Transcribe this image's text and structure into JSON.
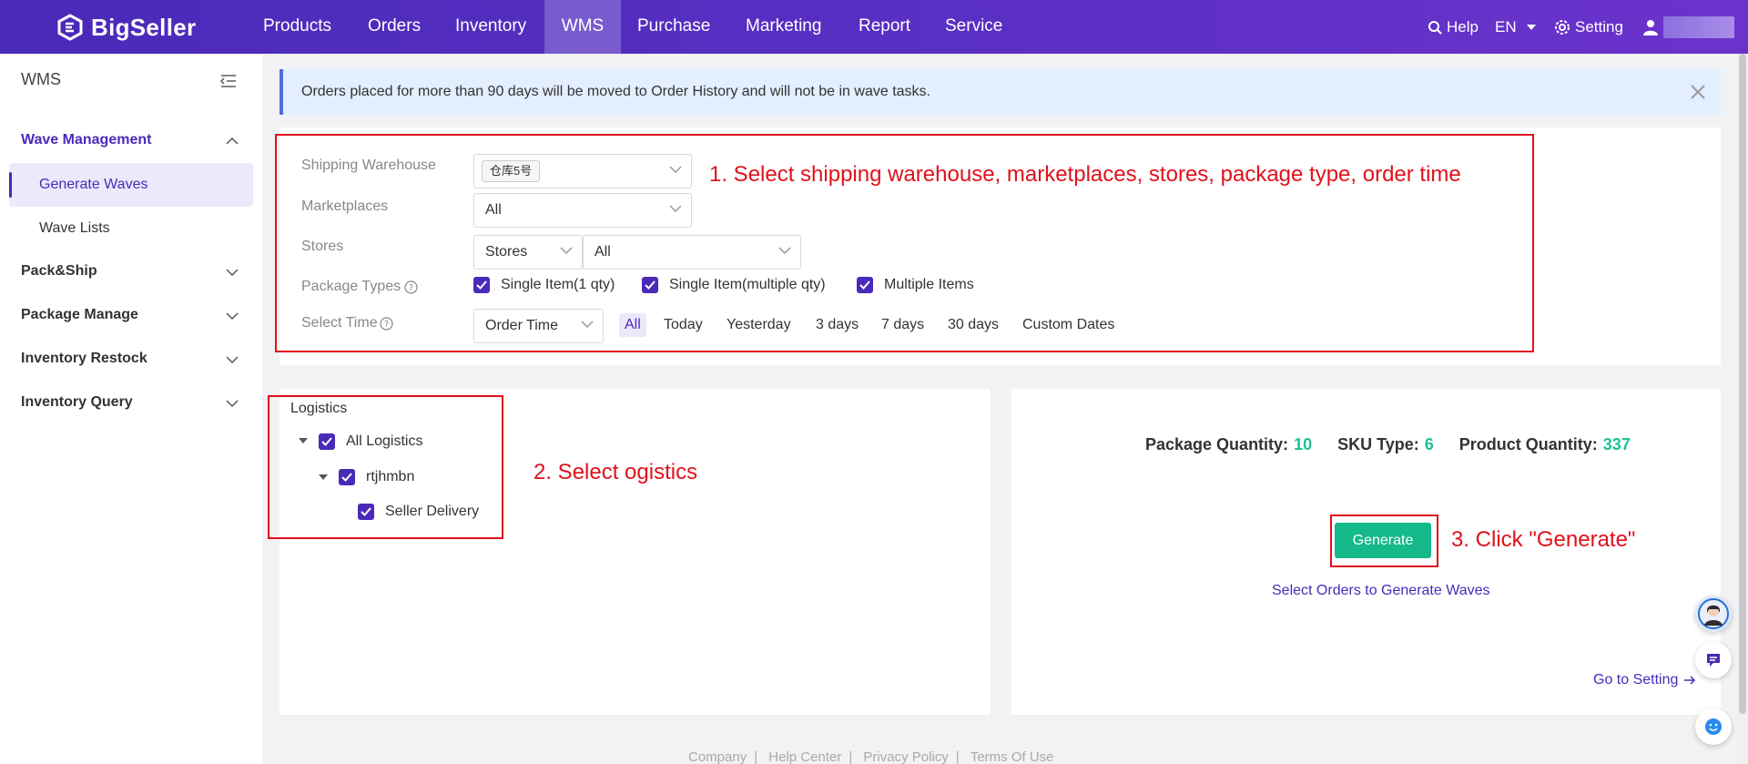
{
  "brand": {
    "name": "BigSeller"
  },
  "nav": {
    "items": [
      "Products",
      "Orders",
      "Inventory",
      "WMS",
      "Purchase",
      "Marketing",
      "Report",
      "Service"
    ],
    "active": "WMS",
    "help": "Help",
    "lang": "EN",
    "setting": "Setting"
  },
  "sidebar": {
    "title": "WMS",
    "groups": [
      {
        "label": "Wave Management",
        "open": true
      },
      {
        "label": "Pack&Ship"
      },
      {
        "label": "Package Manage"
      },
      {
        "label": "Inventory Restock"
      },
      {
        "label": "Inventory Query"
      }
    ],
    "sub_items": [
      {
        "label": "Generate Waves",
        "active": true
      },
      {
        "label": "Wave Lists"
      }
    ]
  },
  "notice": {
    "text": "Orders placed for more than 90 days will be moved to Order History and will not be in wave tasks."
  },
  "filters": {
    "shipping_warehouse": {
      "label": "Shipping Warehouse",
      "value": "仓库5号"
    },
    "marketplaces": {
      "label": "Marketplaces",
      "value": "All"
    },
    "stores": {
      "label": "Stores",
      "type": "Stores",
      "value": "All"
    },
    "package_types": {
      "label": "Package Types",
      "options": [
        "Single Item(1 qty)",
        "Single Item(multiple qty)",
        "Multiple Items"
      ]
    },
    "select_time": {
      "label": "Select Time",
      "type": "Order Time",
      "options": [
        "All",
        "Today",
        "Yesterday",
        "3 days",
        "7 days",
        "30 days",
        "Custom Dates"
      ],
      "active": "All"
    }
  },
  "logistics": {
    "title": "Logistics",
    "tree": [
      "All Logistics",
      "rtjhmbn",
      "Seller Delivery"
    ]
  },
  "stats": {
    "package_quantity_label": "Package Quantity:",
    "package_quantity": "10",
    "sku_type_label": "SKU Type:",
    "sku_type": "6",
    "product_quantity_label": "Product Quantity:",
    "product_quantity": "337"
  },
  "actions": {
    "generate": "Generate",
    "select_orders": "Select Orders to Generate Waves",
    "go_to_setting": "Go to Setting"
  },
  "annotations": {
    "step1": "1. Select shipping warehouse, marketplaces, stores, package type, order time",
    "step2": "2. Select ogistics",
    "step3": "3. Click \"Generate\""
  },
  "footer": [
    "Company",
    "Help Center",
    "Privacy Policy",
    "Terms Of Use"
  ],
  "colors": {
    "brand": "#4a2ab8",
    "accent": "#15b98a",
    "annotation": "#e0111b"
  }
}
